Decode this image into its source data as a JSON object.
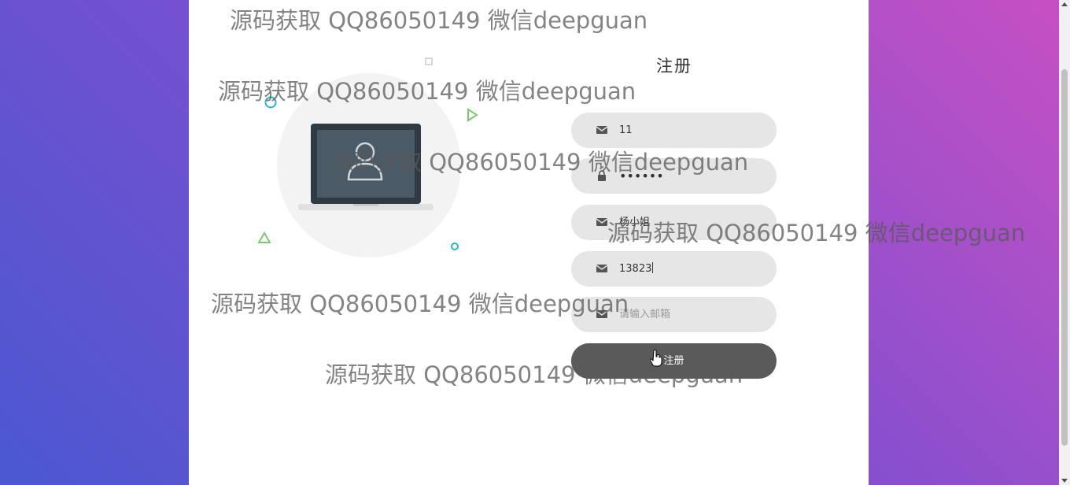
{
  "form": {
    "title": "注册",
    "fields": [
      {
        "icon": "envelope-icon",
        "value": "11",
        "placeholder": ""
      },
      {
        "icon": "lock-icon",
        "value": "••••••",
        "placeholder": ""
      },
      {
        "icon": "envelope-icon",
        "value": "杨小姐",
        "placeholder": ""
      },
      {
        "icon": "envelope-icon",
        "value": "13823",
        "placeholder": ""
      },
      {
        "icon": "envelope-icon",
        "value": "",
        "placeholder": "请输入邮箱"
      }
    ],
    "submit_label": "注册"
  },
  "watermarks": [
    "源码获取 QQ86050149 微信deepguan",
    "源码获取 QQ86050149 微信deepguan",
    "源码获取 QQ86050149 微信deepguan",
    "源码获取 QQ86050149 微信deepguan",
    "源码获取 QQ86050149 微信deepguan",
    "源码获取 QQ86050149 微信deepguan"
  ],
  "colors": {
    "background_start": "#4a58d0",
    "background_end": "#c750c3",
    "button": "#5a5a5a",
    "field_bg": "#e6e6e6"
  }
}
